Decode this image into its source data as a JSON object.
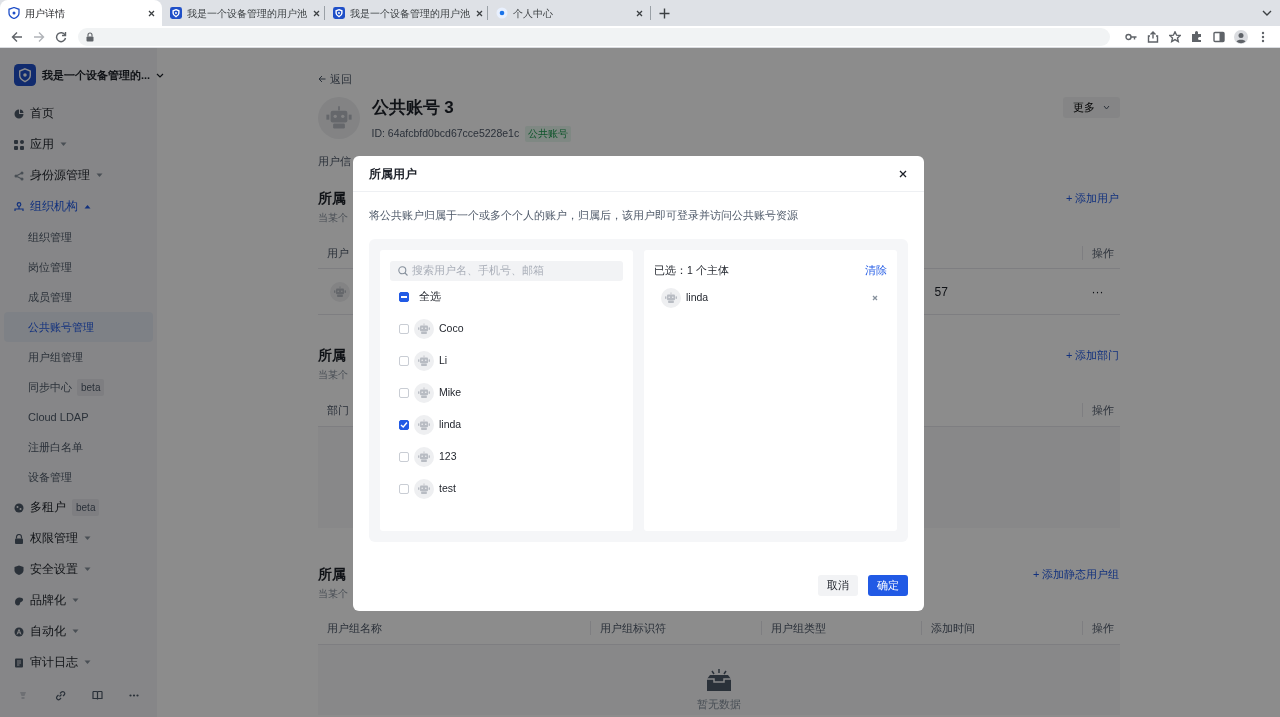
{
  "browser": {
    "tabs": [
      {
        "title": "用户详情",
        "selected": true
      },
      {
        "title": "我是一个设备管理的用户池",
        "selected": false
      },
      {
        "title": "我是一个设备管理的用户池",
        "selected": false
      },
      {
        "title": "个人中心",
        "selected": false
      }
    ]
  },
  "sidebar": {
    "org_name": "我是一个设备管理的...",
    "items": [
      {
        "label": "首页",
        "selected": false
      },
      {
        "label": "应用",
        "selected": false,
        "expanded": false
      },
      {
        "label": "身份源管理",
        "selected": false,
        "expanded": false
      },
      {
        "label": "组织机构",
        "selected": true,
        "expanded": true,
        "children": [
          {
            "label": "组织管理",
            "selected": false
          },
          {
            "label": "岗位管理",
            "selected": false
          },
          {
            "label": "成员管理",
            "selected": false
          },
          {
            "label": "公共账号管理",
            "selected": true
          },
          {
            "label": "用户组管理",
            "selected": false
          },
          {
            "label": "同步中心",
            "badge": "beta",
            "selected": false
          },
          {
            "label": "Cloud LDAP",
            "selected": false
          },
          {
            "label": "注册白名单",
            "selected": false
          },
          {
            "label": "设备管理",
            "selected": false
          }
        ]
      },
      {
        "label": "多租户",
        "badge": "beta",
        "selected": false
      },
      {
        "label": "权限管理",
        "selected": false,
        "expanded": false
      },
      {
        "label": "安全设置",
        "selected": false,
        "expanded": false
      },
      {
        "label": "品牌化",
        "selected": false,
        "expanded": false
      },
      {
        "label": "自动化",
        "selected": false,
        "expanded": false
      },
      {
        "label": "审计日志",
        "selected": false,
        "expanded": false
      }
    ]
  },
  "page": {
    "back": "返回",
    "title": "公共账号 3",
    "id_text": "ID: 64afcbfd0bcd67cce5228e1c",
    "tag": "公共账号",
    "more": "更多",
    "tab_fragment": "用户信",
    "sections": [
      {
        "title": "所属",
        "subtitle": "当某个",
        "action": "+ 添加用户",
        "columns": [
          "用户",
          "操作"
        ],
        "rows": [
          {
            "column_3": "57",
            "menu": "···"
          }
        ]
      },
      {
        "title": "所属",
        "subtitle": "当某个",
        "action": "+ 添加部门",
        "columns": [
          "部门",
          "操作"
        ],
        "empty": true
      },
      {
        "title": "所属",
        "subtitle": "当某个",
        "action": "+ 添加静态用户组",
        "columns": [
          "用户组名称",
          "用户组标识符",
          "用户组类型",
          "添加时间",
          "操作"
        ],
        "empty": true,
        "empty_text": "暂无数据"
      }
    ]
  },
  "modal": {
    "title": "所属用户",
    "description": "将公共账户归属于一个或多个个人的账户，归属后，该用户即可登录并访问公共账号资源",
    "search": {
      "placeholder": "搜索用户名、手机号、邮箱"
    },
    "select_all": {
      "label": "全选",
      "indeterminate": true
    },
    "users": [
      {
        "name": "Coco",
        "checked": false
      },
      {
        "name": "Li",
        "checked": false
      },
      {
        "name": "Mike",
        "checked": false
      },
      {
        "name": "linda",
        "checked": true
      },
      {
        "name": "123",
        "checked": false
      },
      {
        "name": "test",
        "checked": false
      }
    ],
    "selected_summary": "已选：1 个主体",
    "clear": "清除",
    "selected": [
      {
        "name": "linda"
      }
    ],
    "buttons": {
      "cancel": "取消",
      "ok": "确定"
    }
  }
}
